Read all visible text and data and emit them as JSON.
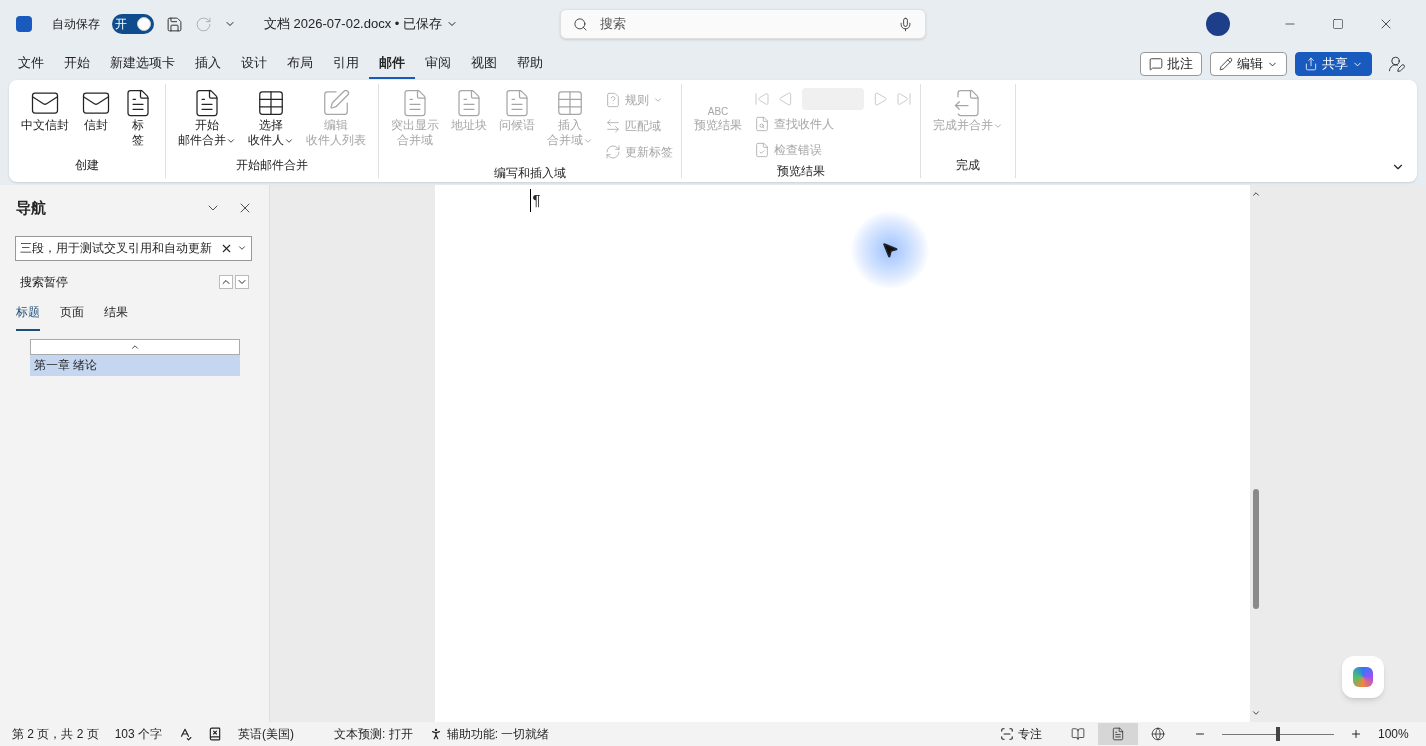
{
  "title_bar": {
    "autosave": {
      "label": "自动保存",
      "on": true,
      "toggle_text": "开"
    },
    "document_title": "文档 2026-07-02.docx • 已保存",
    "search": {
      "placeholder": "搜索"
    }
  },
  "menu_tabs": [
    {
      "label": "文件",
      "selected": false
    },
    {
      "label": "开始",
      "selected": false
    },
    {
      "label": "新建选项卡",
      "selected": false
    },
    {
      "label": "插入",
      "selected": false
    },
    {
      "label": "设计",
      "selected": false
    },
    {
      "label": "布局",
      "selected": false
    },
    {
      "label": "引用",
      "selected": false
    },
    {
      "label": "邮件",
      "selected": true
    },
    {
      "label": "审阅",
      "selected": false
    },
    {
      "label": "视图",
      "selected": false
    },
    {
      "label": "帮助",
      "selected": false
    }
  ],
  "actions": [
    {
      "kind": "comment",
      "label": "批注"
    },
    {
      "kind": "edit",
      "label": "编辑"
    },
    {
      "kind": "share",
      "label": "共享"
    }
  ],
  "ribbon": {
    "groups": [
      {
        "label": "创建",
        "items": [
          {
            "kind": "large",
            "lines": [
              "中文信封"
            ],
            "disabled": false,
            "menu": false
          },
          {
            "kind": "large",
            "lines": [
              "信封"
            ],
            "disabled": false,
            "menu": false
          },
          {
            "kind": "large",
            "lines": [
              "标",
              "签"
            ],
            "disabled": false,
            "menu": false
          }
        ]
      },
      {
        "label": "开始邮件合并",
        "items": [
          {
            "kind": "large",
            "lines": [
              "开始",
              "邮件合并"
            ],
            "disabled": false,
            "menu": true
          },
          {
            "kind": "large",
            "lines": [
              "选择",
              "收件人"
            ],
            "disabled": false,
            "menu": true
          },
          {
            "kind": "large",
            "lines": [
              "编辑",
              "收件人列表"
            ],
            "disabled": true,
            "menu": false
          }
        ]
      },
      {
        "label": "编写和插入域",
        "items": [
          {
            "kind": "large",
            "lines": [
              "突出显示",
              "合并域"
            ],
            "disabled": true,
            "menu": false
          },
          {
            "kind": "large",
            "lines": [
              "地址块"
            ],
            "disabled": true,
            "menu": false
          },
          {
            "kind": "large",
            "lines": [
              "问候语"
            ],
            "disabled": true,
            "menu": false
          },
          {
            "kind": "large",
            "lines": [
              "插入",
              "合并域"
            ],
            "disabled": true,
            "menu": true
          },
          {
            "kind": "small",
            "lines": [
              "规则"
            ],
            "disabled": true,
            "menu": true
          },
          {
            "kind": "small",
            "lines": [
              "匹配域"
            ],
            "disabled": true,
            "menu": false
          },
          {
            "kind": "small",
            "lines": [
              "更新标签"
            ],
            "disabled": true,
            "menu": false
          }
        ]
      },
      {
        "label": "预览结果",
        "items": [
          {
            "kind": "large",
            "icon_text": "ABC",
            "lines": [
              "预览结果"
            ],
            "disabled": true,
            "menu": false
          },
          {
            "kind": "nav",
            "disabled": true
          },
          {
            "kind": "small",
            "lines": [
              "查找收件人"
            ],
            "disabled": true,
            "menu": false
          },
          {
            "kind": "small",
            "lines": [
              "检查错误"
            ],
            "disabled": true,
            "menu": false
          }
        ]
      },
      {
        "label": "完成",
        "items": [
          {
            "kind": "large",
            "lines": [
              "完成并合并"
            ],
            "disabled": true,
            "menu": true
          }
        ]
      }
    ]
  },
  "navigation": {
    "title": "导航",
    "search_value": "三段，用于测试交叉引用和自动更新",
    "status": "搜索暂停",
    "tabs": [
      {
        "label": "标题",
        "selected": true
      },
      {
        "label": "页面",
        "selected": false
      },
      {
        "label": "结果",
        "selected": false
      }
    ],
    "headings": [
      {
        "label": "第一章 绪论",
        "selected": true
      }
    ]
  },
  "document": {
    "mark": "¶"
  },
  "status_bar": {
    "left": [
      {
        "kind": "text",
        "label": "第 2 页，共 2 页"
      },
      {
        "kind": "text",
        "label": "103 个字"
      },
      {
        "kind": "proofing"
      },
      {
        "kind": "track"
      },
      {
        "kind": "text",
        "label": "英语(美国)"
      },
      {
        "kind": "text",
        "label": "文本预测: 打开"
      },
      {
        "kind": "accessibility",
        "label": "辅助功能: 一切就绪"
      }
    ],
    "focus": "专注",
    "views": [
      {
        "kind": "read",
        "selected": false
      },
      {
        "kind": "print",
        "selected": true
      },
      {
        "kind": "web",
        "selected": false
      }
    ],
    "zoom": {
      "level": 0.5,
      "reading": "100%"
    }
  }
}
